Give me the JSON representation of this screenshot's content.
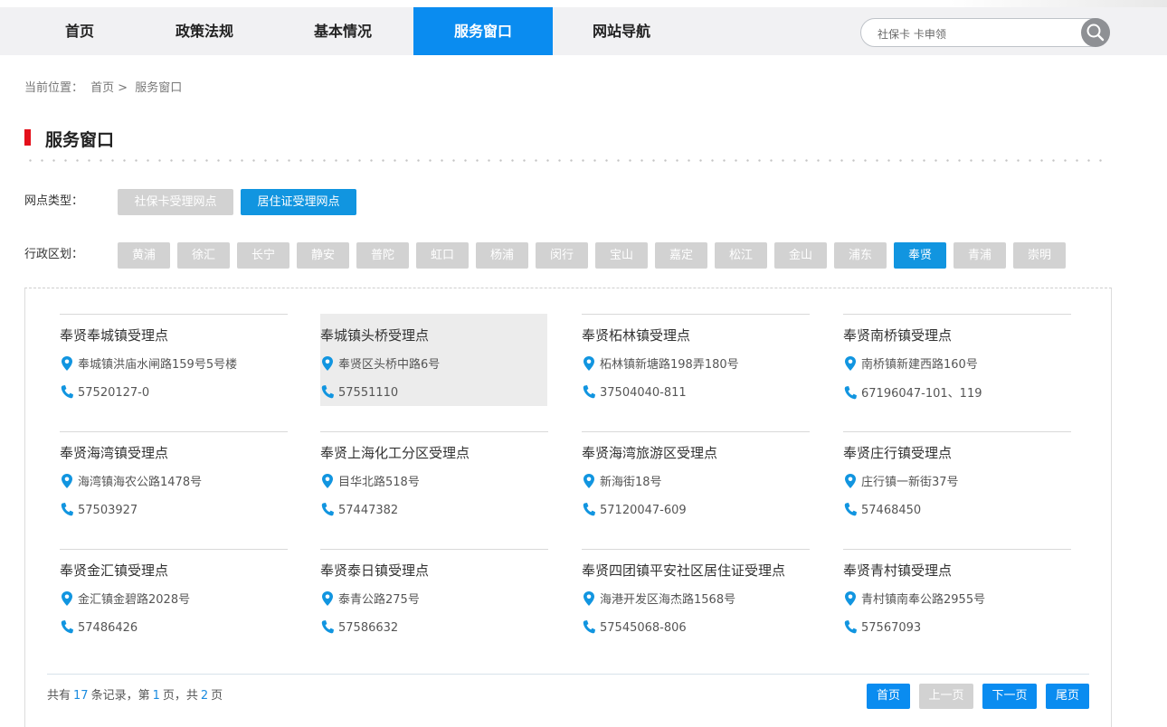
{
  "nav": {
    "items": [
      {
        "label": "首页"
      },
      {
        "label": "政策法规"
      },
      {
        "label": "基本情况"
      },
      {
        "label": "服务窗口"
      },
      {
        "label": "网站导航"
      }
    ],
    "active_index": 3
  },
  "search": {
    "value": "社保卡 卡申领"
  },
  "breadcrumb": {
    "prefix": "当前位置：",
    "home": "首页",
    "sep": ">",
    "current": "服务窗口"
  },
  "section_title": "服务窗口",
  "filters": {
    "type_label": "网点类型：",
    "types": [
      "社保卡受理网点",
      "居住证受理网点"
    ],
    "type_active": 1,
    "district_label": "行政区划：",
    "districts": [
      "黄浦",
      "徐汇",
      "长宁",
      "静安",
      "普陀",
      "虹口",
      "杨浦",
      "闵行",
      "宝山",
      "嘉定",
      "松江",
      "金山",
      "浦东",
      "奉贤",
      "青浦",
      "崇明"
    ],
    "district_active": 13
  },
  "offices": [
    {
      "name": "奉贤奉城镇受理点",
      "address": "奉城镇洪庙水闸路159号5号楼",
      "phone": "57520127-0"
    },
    {
      "name": "奉城镇头桥受理点",
      "address": "奉贤区头桥中路6号",
      "phone": "57551110"
    },
    {
      "name": "奉贤柘林镇受理点",
      "address": "柘林镇新塘路198弄180号",
      "phone": "37504040-811"
    },
    {
      "name": "奉贤南桥镇受理点",
      "address": "南桥镇新建西路160号",
      "phone": "67196047-101、119"
    },
    {
      "name": "奉贤海湾镇受理点",
      "address": "海湾镇海农公路1478号",
      "phone": "57503927"
    },
    {
      "name": "奉贤上海化工分区受理点",
      "address": "目华北路518号",
      "phone": "57447382"
    },
    {
      "name": "奉贤海湾旅游区受理点",
      "address": "新海街18号",
      "phone": "57120047-609"
    },
    {
      "name": "奉贤庄行镇受理点",
      "address": "庄行镇一新街37号",
      "phone": "57468450"
    },
    {
      "name": "奉贤金汇镇受理点",
      "address": "金汇镇金碧路2028号",
      "phone": "57486426"
    },
    {
      "name": "奉贤泰日镇受理点",
      "address": "泰青公路275号",
      "phone": "57586632"
    },
    {
      "name": "奉贤四团镇平安社区居住证受理点",
      "address": "海港开发区海杰路1568号",
      "phone": "57545068-806"
    },
    {
      "name": "奉贤青村镇受理点",
      "address": "青村镇南奉公路2955号",
      "phone": "57567093"
    }
  ],
  "highlighted_index": 1,
  "pagination": {
    "t1": "共有",
    "total": "17",
    "t2": "条记录，第",
    "page": "1",
    "t3": "页，共",
    "pages": "2",
    "t4": "页",
    "first": "首页",
    "prev": "上一页",
    "next": "下一页",
    "last": "尾页"
  },
  "colors": {
    "accent": "#0a8cf0",
    "tag_active": "#1195e0",
    "marker": "#e4101b",
    "icon": "#1195e0"
  }
}
